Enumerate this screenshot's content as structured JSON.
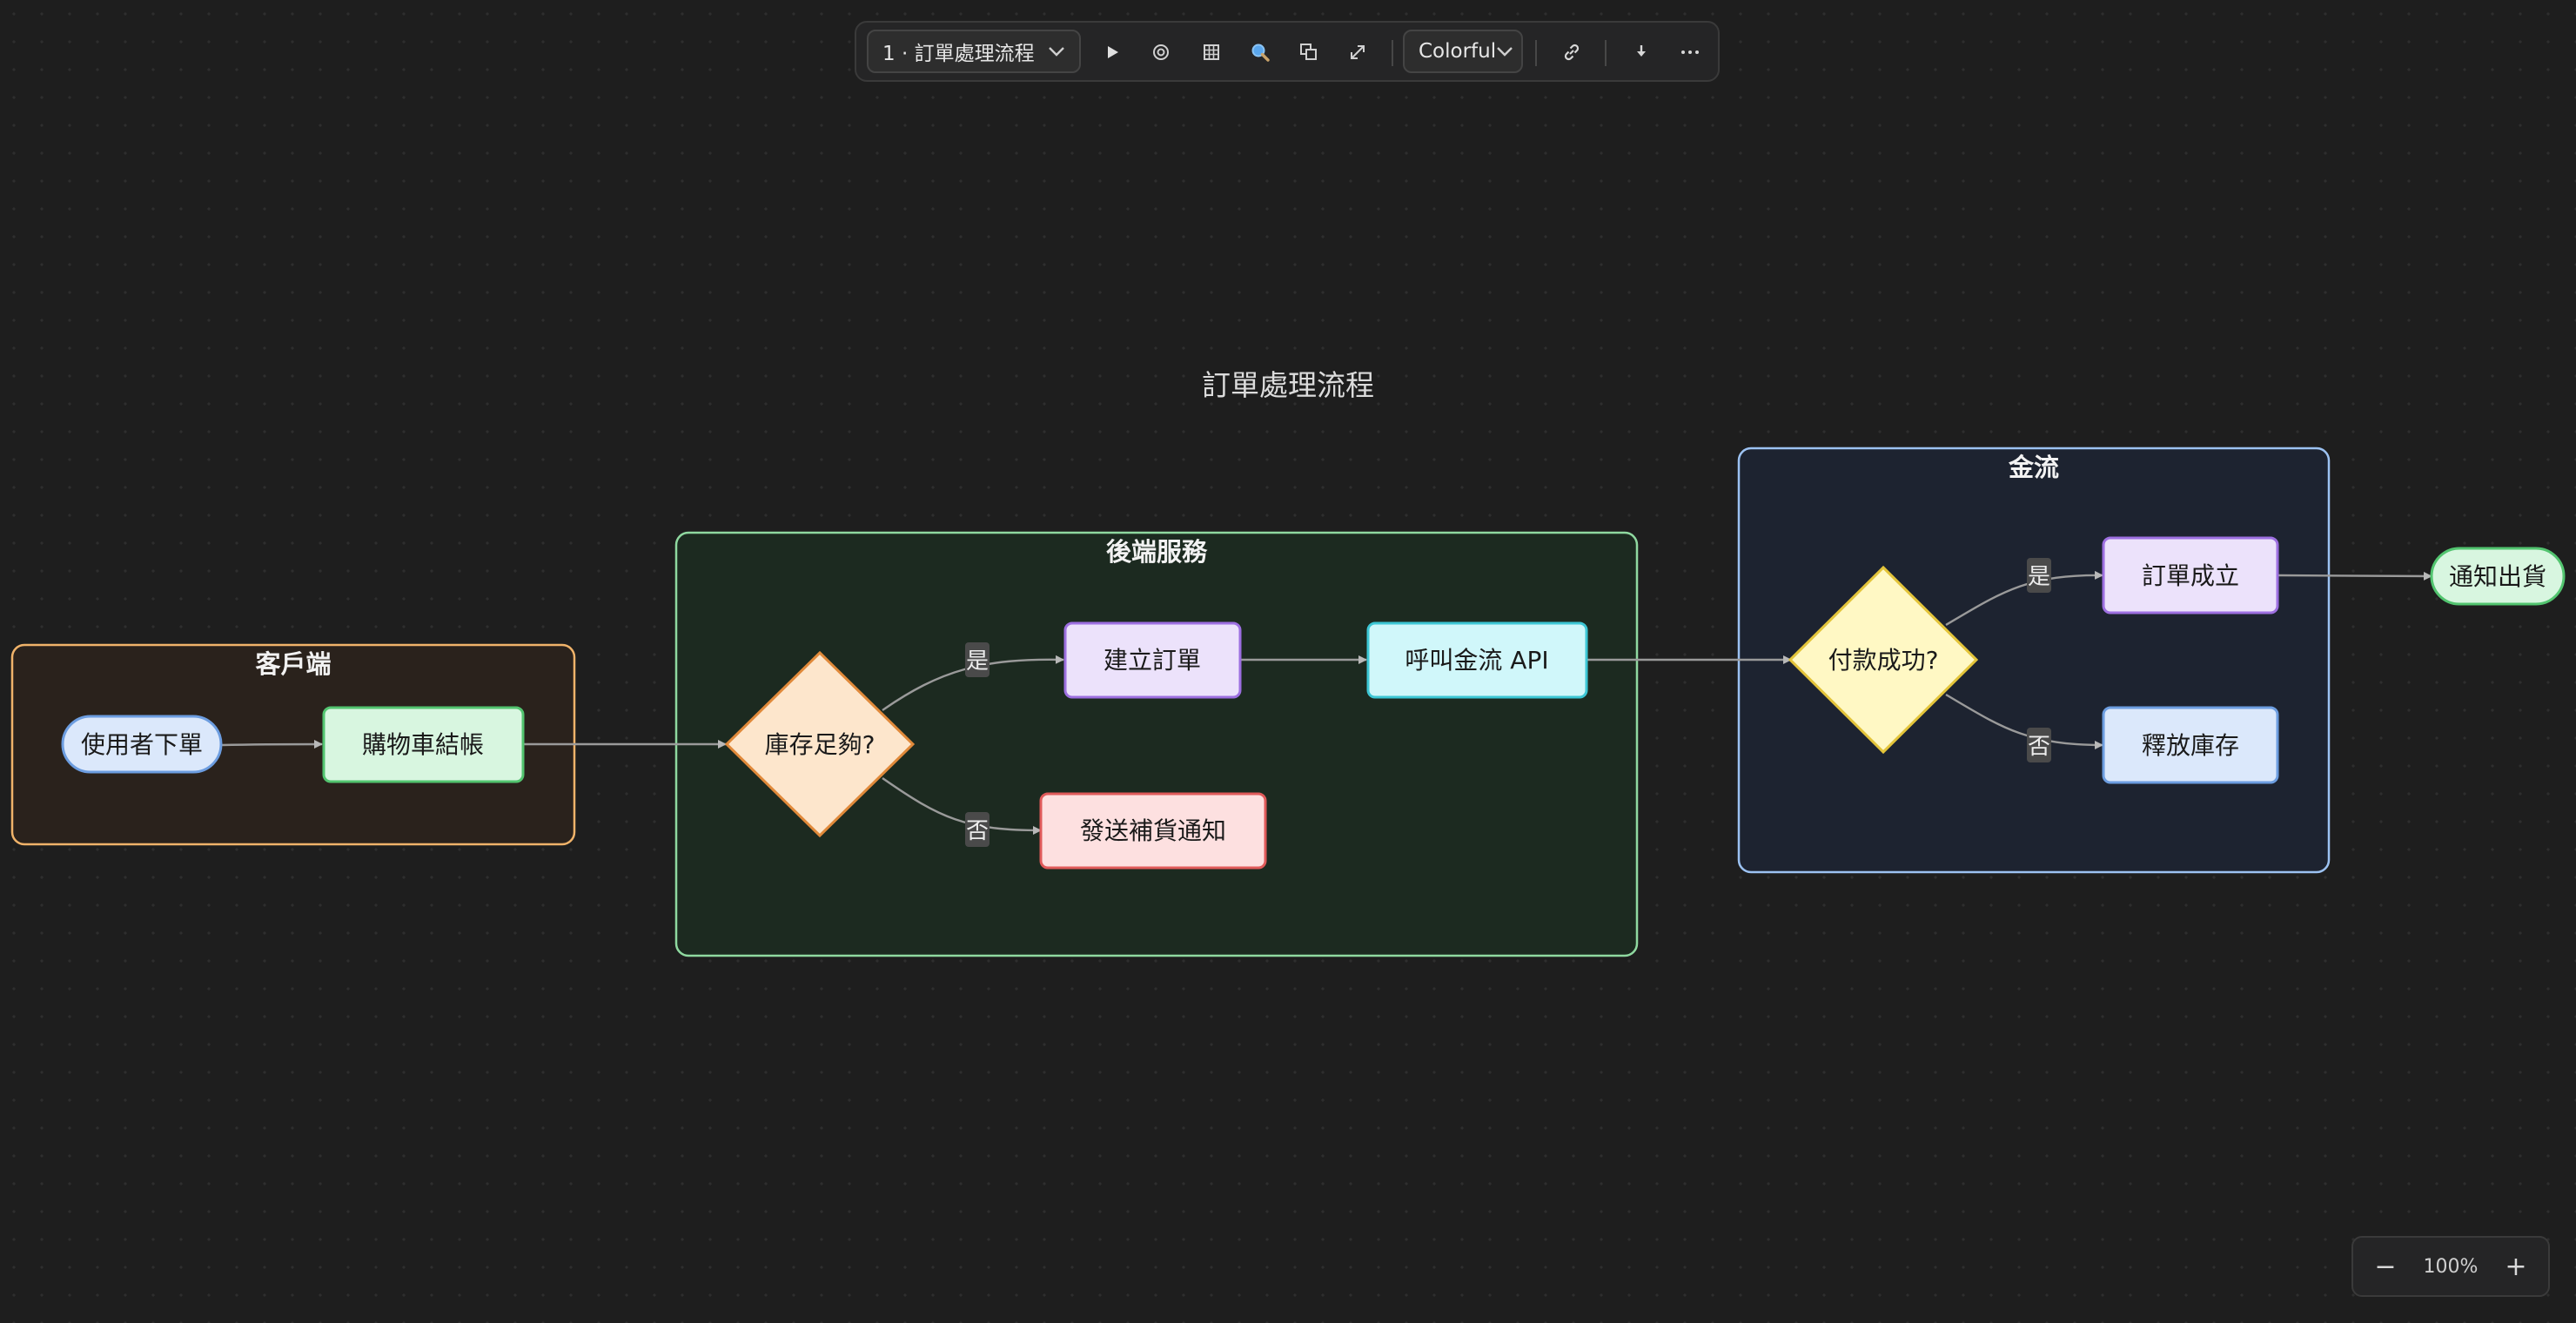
{
  "toolbar": {
    "diagram_select": "1 · 訂單處理流程",
    "theme_select": "Colorful",
    "icons": [
      "play-icon",
      "target-icon",
      "grid-icon",
      "magnifier-icon",
      "copy-icon",
      "expand-icon",
      "link-icon",
      "download-icon",
      "more-icon"
    ]
  },
  "zoom": {
    "minus": "−",
    "level": "100%",
    "plus": "+"
  },
  "diagram": {
    "title": "訂單處理流程",
    "groups": {
      "client": {
        "label": "客戶端",
        "border": "#f0b36a"
      },
      "backend": {
        "label": "後端服務",
        "border": "#8fd9a0"
      },
      "payment": {
        "label": "金流",
        "border": "#9cc2f2"
      }
    },
    "nodes": {
      "place_order": "使用者下單",
      "checkout": "購物車結帳",
      "stock_check": "庫存足夠?",
      "create_order": "建立訂單",
      "call_api": "呼叫金流 API",
      "send_restock": "發送補貨通知",
      "payment_ok": "付款成功?",
      "order_done": "訂單成立",
      "release_stock": "釋放庫存",
      "notify_ship": "通知出貨"
    },
    "edge_labels": {
      "stock_yes": "是",
      "stock_no": "否",
      "pay_yes": "是",
      "pay_no": "否"
    }
  }
}
